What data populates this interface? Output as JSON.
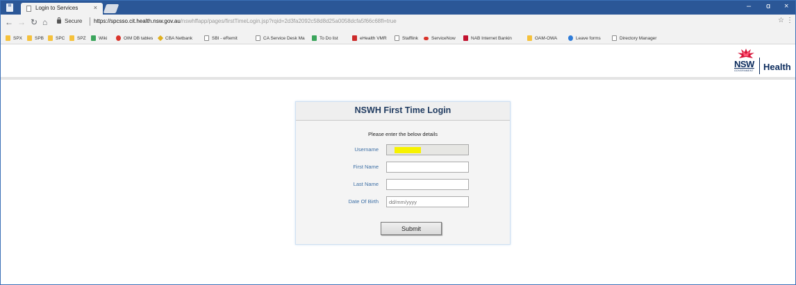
{
  "tabs": [
    {
      "title": "Login to Services",
      "close": "×"
    }
  ],
  "window": {
    "minimize": "–",
    "restore": "ɑ",
    "close": "×"
  },
  "address_bar": {
    "secure_label": "Secure",
    "url_host": "https://spcsso.cit.health.nsw.gov.au",
    "url_path": "/nswhffapp/pages/firstTimeLogin.jsp?rqid=2d3fa2092c58d8d25a0058dcfa5f66c68fl=true"
  },
  "bookmarks": [
    {
      "label": "SPX",
      "icon": "folder"
    },
    {
      "label": "SPB",
      "icon": "folder"
    },
    {
      "label": "SPC",
      "icon": "folder"
    },
    {
      "label": "SPZ",
      "icon": "folder"
    },
    {
      "label": "Wiki",
      "icon": "sheet"
    },
    {
      "label": "OIM DB tables",
      "icon": "red"
    },
    {
      "label": "CBA Netbank",
      "icon": "diamond"
    },
    {
      "label": "SBI - eRemit",
      "icon": "page"
    },
    {
      "label": "CA Service Desk Ma",
      "icon": "page"
    },
    {
      "label": "To Do list",
      "icon": "sheet"
    },
    {
      "label": "eHealth VMR",
      "icon": "calendar"
    },
    {
      "label": "Stafflink",
      "icon": "page"
    },
    {
      "label": "ServiceNow",
      "icon": "sn"
    },
    {
      "label": "NAB Internet Bankin",
      "icon": "nab"
    },
    {
      "label": "OAM-OWA",
      "icon": "folder"
    },
    {
      "label": "Leave forms",
      "icon": "leave"
    },
    {
      "label": "Directory Manager",
      "icon": "page"
    }
  ],
  "logo": {
    "nsw": "NSW",
    "government": "GOVERNMENT",
    "health": "Health"
  },
  "login": {
    "title": "NSWH First Time Login",
    "instructions": "Please enter the below details",
    "username_label": "Username",
    "first_name_label": "First Name",
    "last_name_label": "Last Name",
    "dob_label": "Date Of Birth",
    "dob_placeholder": "dd/mm/yyyy",
    "submit_label": "Submit"
  },
  "colors": {
    "tab_strip": "#2b5797",
    "label_blue": "#3d6fa5",
    "title_navy": "#1f3a5f",
    "highlight": "#f7f200"
  }
}
